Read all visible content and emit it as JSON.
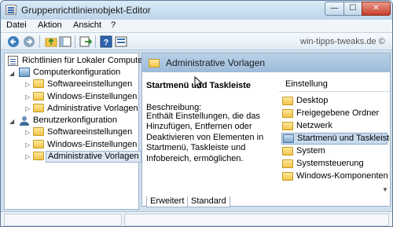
{
  "window": {
    "title": "Gruppenrichtlinienobjekt-Editor",
    "buttons": {
      "minimize": "—",
      "maximize": "☐",
      "close": "✕"
    }
  },
  "menu": {
    "items": [
      "Datei",
      "Aktion",
      "Ansicht",
      "?"
    ]
  },
  "toolbar": {
    "icons": [
      "back-icon",
      "forward-icon",
      "up-folder-icon",
      "tree-toggle-icon",
      "export-icon",
      "help-icon",
      "view-icon"
    ],
    "watermark": "win-tipps-tweaks.de ©"
  },
  "tree": {
    "root": "Richtlinien für Lokaler Computer",
    "computer": {
      "label": "Computerkonfiguration",
      "children": [
        "Softwareeinstellungen",
        "Windows-Einstellungen",
        "Administrative Vorlagen"
      ]
    },
    "user": {
      "label": "Benutzerkonfiguration",
      "children": [
        "Softwareeinstellungen",
        "Windows-Einstellungen",
        "Administrative Vorlagen"
      ]
    }
  },
  "details": {
    "header": "Administrative Vorlagen",
    "title": "Startmenü und Taskleiste",
    "description_label": "Beschreibung:",
    "description": "Enthält Einstellungen, die das Hinzufügen, Entfernen oder Deaktivieren von Elementen in Startmenü, Taskleiste und Infobereich, ermöglichen.",
    "column_header": "Einstellung",
    "items": [
      "Desktop",
      "Freigegebene Ordner",
      "Netzwerk",
      "Startmenü und Taskleiste",
      "System",
      "Systemsteuerung",
      "Windows-Komponenten"
    ],
    "selected_item": "Startmenü und Taskleiste"
  },
  "tabs": [
    "Erweitert",
    "Standard"
  ],
  "colors": {
    "header_bar": "#9cbbda",
    "selection": "#c9dcef",
    "close_button": "#c7402a"
  }
}
